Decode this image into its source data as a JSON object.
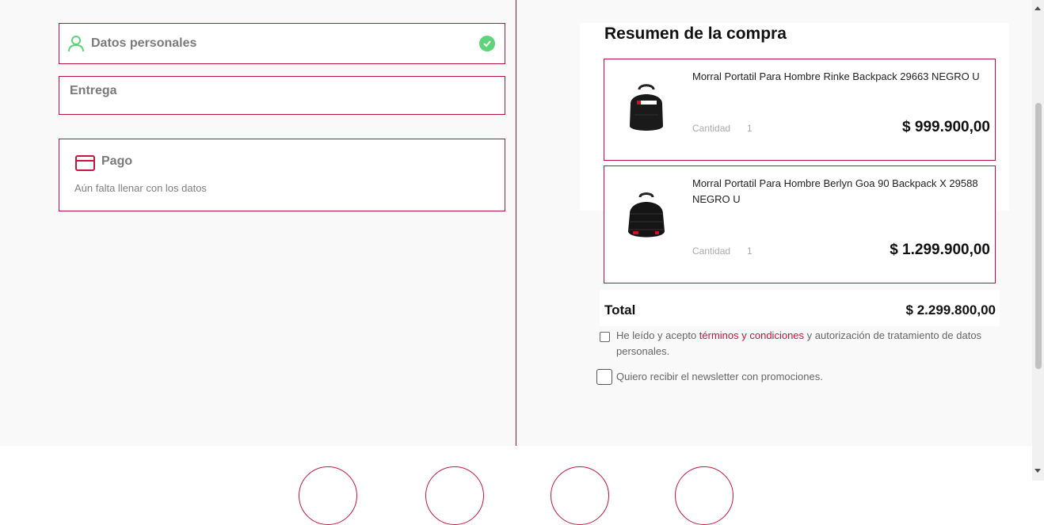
{
  "checkout_steps": {
    "personal": {
      "title": "Datos personales",
      "completed": true,
      "icon": "user-icon",
      "check_icon": "check-circle-icon"
    },
    "delivery": {
      "title": "Entrega"
    },
    "payment": {
      "title": "Pago",
      "subtitle": "Aún falta llenar con los datos",
      "icon": "credit-card-icon"
    }
  },
  "summary": {
    "title": "Resumen de la compra",
    "items": [
      {
        "name": "Morral Portatil Para Hombre Rinke Backpack 29663 NEGRO U",
        "quantity_label": "Cantidad",
        "quantity": "1",
        "price": "$ 999.900,00",
        "image": "backpack-image"
      },
      {
        "name": "Morral Portatil Para Hombre Berlyn Goa 90 Backpack X 29588 NEGRO U",
        "quantity_label": "Cantidad",
        "quantity": "1",
        "price": "$ 1.299.900,00",
        "image": "backpack-image"
      }
    ],
    "total_label": "Total",
    "total_value": "$ 2.299.800,00"
  },
  "terms": {
    "prefix": "He leído y acepto ",
    "link": "términos y condiciones",
    "suffix": " y autorización de tratamiento de datos personales."
  },
  "newsletter": {
    "label": "Quiero recibir el newsletter con promociones."
  },
  "colors": {
    "accent": "#b5123f",
    "link": "#c8143f",
    "success": "#5ed37a",
    "muted_text": "#7a7a7a"
  }
}
